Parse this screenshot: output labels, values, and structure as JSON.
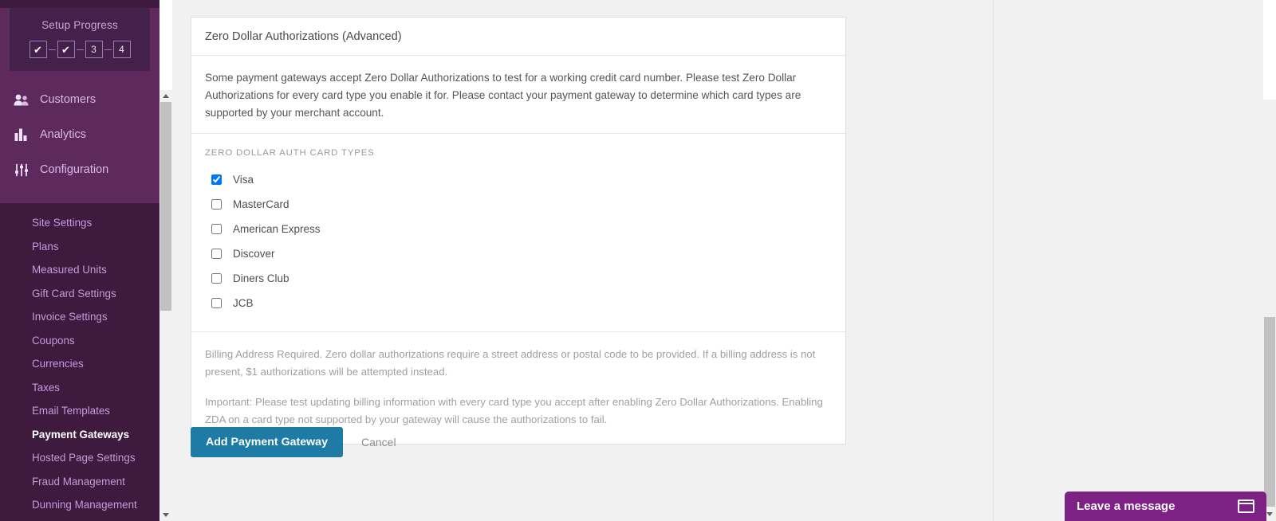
{
  "sidebar": {
    "setup": {
      "title": "Setup Progress",
      "steps": [
        {
          "label": "✔",
          "state": "done"
        },
        {
          "label": "✔",
          "state": "done"
        },
        {
          "label": "3",
          "state": "pending"
        },
        {
          "label": "4",
          "state": "pending"
        }
      ]
    },
    "nav_main": [
      {
        "label": "Customers",
        "icon": "customers-icon",
        "active": false
      },
      {
        "label": "Analytics",
        "icon": "analytics-icon",
        "active": false
      },
      {
        "label": "Configuration",
        "icon": "configuration-icon",
        "active": true
      }
    ],
    "nav_sub": [
      {
        "label": "Site Settings",
        "selected": false
      },
      {
        "label": "Plans",
        "selected": false
      },
      {
        "label": "Measured Units",
        "selected": false
      },
      {
        "label": "Gift Card Settings",
        "selected": false
      },
      {
        "label": "Invoice Settings",
        "selected": false
      },
      {
        "label": "Coupons",
        "selected": false
      },
      {
        "label": "Currencies",
        "selected": false
      },
      {
        "label": "Taxes",
        "selected": false
      },
      {
        "label": "Email Templates",
        "selected": false
      },
      {
        "label": "Payment Gateways",
        "selected": true
      },
      {
        "label": "Hosted Page Settings",
        "selected": false
      },
      {
        "label": "Fraud Management",
        "selected": false
      },
      {
        "label": "Dunning Management",
        "selected": false
      }
    ],
    "colors": {
      "top_bg": "#5e2a5e",
      "sub_bg": "#3e1a3e",
      "setup_bg": "#43214a",
      "link": "#c79ad8"
    }
  },
  "card": {
    "title": "Zero Dollar Authorizations (Advanced)",
    "intro": "Some payment gateways accept Zero Dollar Authorizations to test for a working credit card number. Please test Zero Dollar Authorizations for every card type you enable it for. Please contact your payment gateway to determine which card types are supported by your merchant account.",
    "section_label": "ZERO DOLLAR AUTH CARD TYPES",
    "card_types": [
      {
        "label": "Visa",
        "checked": true
      },
      {
        "label": "MasterCard",
        "checked": false
      },
      {
        "label": "American Express",
        "checked": false
      },
      {
        "label": "Discover",
        "checked": false
      },
      {
        "label": "Diners Club",
        "checked": false
      },
      {
        "label": "JCB",
        "checked": false
      }
    ],
    "footer_notes": [
      "Billing Address Required. Zero dollar authorizations require a street address or postal code to be provided. If a billing address is not present, $1 authorizations will be attempted instead.",
      "Important: Please test updating billing information with every card type you accept after enabling Zero Dollar Authorizations. Enabling ZDA on a card type not supported by your gateway will cause the authorizations to fail."
    ]
  },
  "actions": {
    "submit_label": "Add Payment Gateway",
    "cancel_label": "Cancel",
    "submit_color": "#1d7ba6"
  },
  "chat": {
    "label": "Leave a message",
    "icon": "chat-window-icon",
    "color": "#7d2184"
  }
}
